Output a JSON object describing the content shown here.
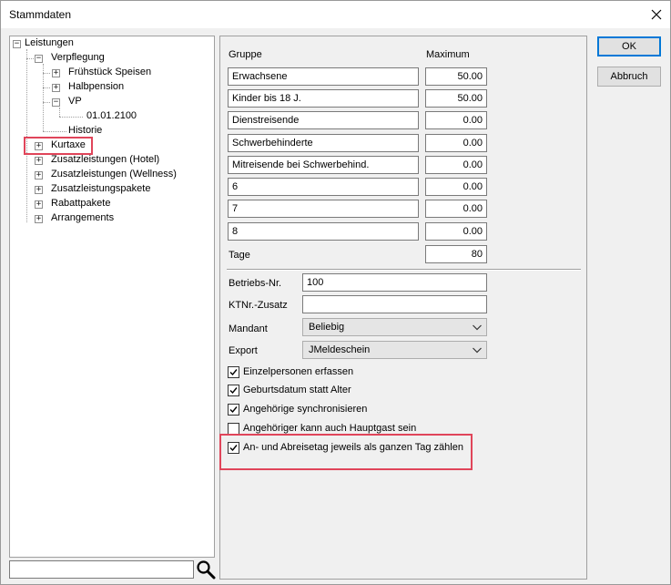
{
  "window": {
    "title": "Stammdaten"
  },
  "tree": {
    "nodes": [
      {
        "label": "Leistungen"
      },
      {
        "label": "Verpflegung"
      },
      {
        "label": "Frühstück Speisen"
      },
      {
        "label": "Halbpension"
      },
      {
        "label": "VP"
      },
      {
        "label": "01.01.2100"
      },
      {
        "label": "Historie"
      },
      {
        "label": "Kurtaxe"
      },
      {
        "label": "Zusatzleistungen (Hotel)"
      },
      {
        "label": "Zusatzleistungen (Wellness)"
      },
      {
        "label": "Zusatzleistungspakete"
      },
      {
        "label": "Rabattpakete"
      },
      {
        "label": "Arrangements"
      }
    ],
    "search_value": ""
  },
  "groups": {
    "header_group": "Gruppe",
    "header_max": "Maximum",
    "rows": [
      {
        "name": "Erwachsene",
        "max": "50.00"
      },
      {
        "name": "Kinder bis 18 J.",
        "max": "50.00"
      },
      {
        "name": "Dienstreisende",
        "max": "0.00"
      },
      {
        "name": "Schwerbehinderte",
        "max": "0.00"
      },
      {
        "name": "Mitreisende bei Schwerbehind.",
        "max": "0.00"
      },
      {
        "name": "6",
        "max": "0.00"
      },
      {
        "name": "7",
        "max": "0.00"
      },
      {
        "name": "8",
        "max": "0.00"
      }
    ],
    "tage_label": "Tage",
    "tage_value": "80"
  },
  "form": {
    "betriebs_label": "Betriebs-Nr.",
    "betriebs_value": "100",
    "ktnr_label": "KTNr.-Zusatz",
    "ktnr_value": "",
    "mandant_label": "Mandant",
    "mandant_value": "Beliebig",
    "export_label": "Export",
    "export_value": "JMeldeschein"
  },
  "checkboxes": [
    {
      "label": "Einzelpersonen erfassen",
      "checked": true
    },
    {
      "label": "Geburtsdatum statt Alter",
      "checked": true
    },
    {
      "label": "Angehörige synchronisieren",
      "checked": true
    },
    {
      "label": "Angehöriger kann auch Hauptgast sein",
      "checked": false
    },
    {
      "label": "An- und Abreisetag jeweils als ganzen Tag zählen",
      "checked": true
    }
  ],
  "buttons": {
    "ok": "OK",
    "cancel": "Abbruch"
  },
  "colors": {
    "highlight": "#e0455a",
    "default_button_border": "#0078d7"
  }
}
